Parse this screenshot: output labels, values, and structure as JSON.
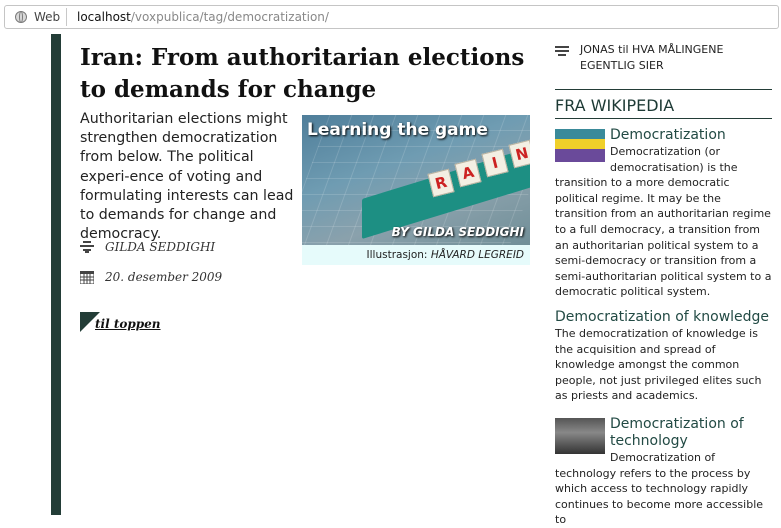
{
  "browser": {
    "chip_label": "Web",
    "url_host": "localhost",
    "url_path": "/voxpublica/tag/democratization/"
  },
  "article": {
    "title": "Iran: From authoritarian elections to demands for change",
    "summary": "Authoritarian elections might strengthen democratization from below. The political experi-ence of voting and formulating interests can lead to demands for change and democracy.",
    "author": "GILDA SEDDIGHI",
    "date": "20. desember 2009",
    "to_top": "til toppen",
    "illustration": {
      "title": "Learning the game",
      "tiles": [
        "R",
        "A",
        "I",
        "N"
      ],
      "byline": "BY GILDA SEDDIGHI",
      "credit_label": "Illustrasjon:",
      "credit_name": "HÅVARD LEGREID"
    }
  },
  "sidebar": {
    "comment": "JONAS til HVA MÅLINGENE EGENTLIG SIER",
    "wiki_heading": "FRA WIKIPEDIA",
    "items": [
      {
        "title": "Democratization",
        "text": "Democratization (or democratisation) is the transition to a more democratic political regime. It may be the transition from an authoritarian regime to a full democracy, a transition from an authoritarian political system to a semi-democracy or transition from a semi-authoritarian political system to a democratic political system."
      },
      {
        "title": "Democratization of knowledge",
        "text": "The democratization of knowledge is the acquisition and spread of knowledge amongst the common people, not just privileged elites such as priests and academics."
      },
      {
        "title": "Democratization of technology",
        "text": "Democratization of technology refers to the process by which access to technology rapidly continues to become more accessible to"
      }
    ]
  },
  "colors": {
    "accent": "#233d37",
    "credit_bg": "#e6fbfb"
  },
  "icons": [
    "globe-icon",
    "author-icon",
    "calendar-icon",
    "comment-icon"
  ]
}
